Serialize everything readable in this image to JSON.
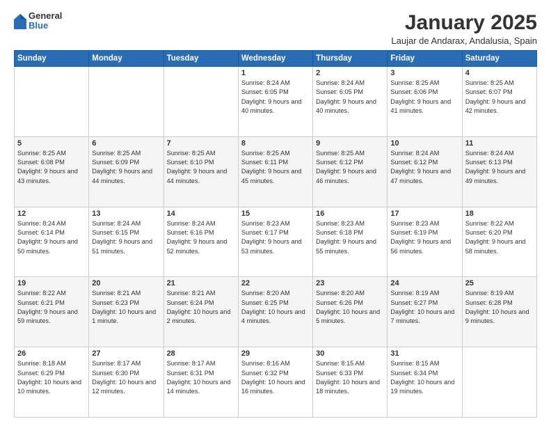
{
  "logo": {
    "general": "General",
    "blue": "Blue"
  },
  "header": {
    "month": "January 2025",
    "location": "Laujar de Andarax, Andalusia, Spain"
  },
  "days_of_week": [
    "Sunday",
    "Monday",
    "Tuesday",
    "Wednesday",
    "Thursday",
    "Friday",
    "Saturday"
  ],
  "weeks": [
    [
      {
        "day": "",
        "info": ""
      },
      {
        "day": "",
        "info": ""
      },
      {
        "day": "",
        "info": ""
      },
      {
        "day": "1",
        "info": "Sunrise: 8:24 AM\nSunset: 6:05 PM\nDaylight: 9 hours and 40 minutes."
      },
      {
        "day": "2",
        "info": "Sunrise: 8:24 AM\nSunset: 6:05 PM\nDaylight: 9 hours and 40 minutes."
      },
      {
        "day": "3",
        "info": "Sunrise: 8:25 AM\nSunset: 6:06 PM\nDaylight: 9 hours and 41 minutes."
      },
      {
        "day": "4",
        "info": "Sunrise: 8:25 AM\nSunset: 6:07 PM\nDaylight: 9 hours and 42 minutes."
      }
    ],
    [
      {
        "day": "5",
        "info": "Sunrise: 8:25 AM\nSunset: 6:08 PM\nDaylight: 9 hours and 43 minutes."
      },
      {
        "day": "6",
        "info": "Sunrise: 8:25 AM\nSunset: 6:09 PM\nDaylight: 9 hours and 44 minutes."
      },
      {
        "day": "7",
        "info": "Sunrise: 8:25 AM\nSunset: 6:10 PM\nDaylight: 9 hours and 44 minutes."
      },
      {
        "day": "8",
        "info": "Sunrise: 8:25 AM\nSunset: 6:11 PM\nDaylight: 9 hours and 45 minutes."
      },
      {
        "day": "9",
        "info": "Sunrise: 8:25 AM\nSunset: 6:12 PM\nDaylight: 9 hours and 46 minutes."
      },
      {
        "day": "10",
        "info": "Sunrise: 8:24 AM\nSunset: 6:12 PM\nDaylight: 9 hours and 47 minutes."
      },
      {
        "day": "11",
        "info": "Sunrise: 8:24 AM\nSunset: 6:13 PM\nDaylight: 9 hours and 49 minutes."
      }
    ],
    [
      {
        "day": "12",
        "info": "Sunrise: 8:24 AM\nSunset: 6:14 PM\nDaylight: 9 hours and 50 minutes."
      },
      {
        "day": "13",
        "info": "Sunrise: 8:24 AM\nSunset: 6:15 PM\nDaylight: 9 hours and 51 minutes."
      },
      {
        "day": "14",
        "info": "Sunrise: 8:24 AM\nSunset: 6:16 PM\nDaylight: 9 hours and 52 minutes."
      },
      {
        "day": "15",
        "info": "Sunrise: 8:23 AM\nSunset: 6:17 PM\nDaylight: 9 hours and 53 minutes."
      },
      {
        "day": "16",
        "info": "Sunrise: 8:23 AM\nSunset: 6:18 PM\nDaylight: 9 hours and 55 minutes."
      },
      {
        "day": "17",
        "info": "Sunrise: 8:23 AM\nSunset: 6:19 PM\nDaylight: 9 hours and 56 minutes."
      },
      {
        "day": "18",
        "info": "Sunrise: 8:22 AM\nSunset: 6:20 PM\nDaylight: 9 hours and 58 minutes."
      }
    ],
    [
      {
        "day": "19",
        "info": "Sunrise: 8:22 AM\nSunset: 6:21 PM\nDaylight: 9 hours and 59 minutes."
      },
      {
        "day": "20",
        "info": "Sunrise: 8:21 AM\nSunset: 6:23 PM\nDaylight: 10 hours and 1 minute."
      },
      {
        "day": "21",
        "info": "Sunrise: 8:21 AM\nSunset: 6:24 PM\nDaylight: 10 hours and 2 minutes."
      },
      {
        "day": "22",
        "info": "Sunrise: 8:20 AM\nSunset: 6:25 PM\nDaylight: 10 hours and 4 minutes."
      },
      {
        "day": "23",
        "info": "Sunrise: 8:20 AM\nSunset: 6:26 PM\nDaylight: 10 hours and 5 minutes."
      },
      {
        "day": "24",
        "info": "Sunrise: 8:19 AM\nSunset: 6:27 PM\nDaylight: 10 hours and 7 minutes."
      },
      {
        "day": "25",
        "info": "Sunrise: 8:19 AM\nSunset: 6:28 PM\nDaylight: 10 hours and 9 minutes."
      }
    ],
    [
      {
        "day": "26",
        "info": "Sunrise: 8:18 AM\nSunset: 6:29 PM\nDaylight: 10 hours and 10 minutes."
      },
      {
        "day": "27",
        "info": "Sunrise: 8:17 AM\nSunset: 6:30 PM\nDaylight: 10 hours and 12 minutes."
      },
      {
        "day": "28",
        "info": "Sunrise: 8:17 AM\nSunset: 6:31 PM\nDaylight: 10 hours and 14 minutes."
      },
      {
        "day": "29",
        "info": "Sunrise: 8:16 AM\nSunset: 6:32 PM\nDaylight: 10 hours and 16 minutes."
      },
      {
        "day": "30",
        "info": "Sunrise: 8:15 AM\nSunset: 6:33 PM\nDaylight: 10 hours and 18 minutes."
      },
      {
        "day": "31",
        "info": "Sunrise: 8:15 AM\nSunset: 6:34 PM\nDaylight: 10 hours and 19 minutes."
      },
      {
        "day": "",
        "info": ""
      }
    ]
  ]
}
